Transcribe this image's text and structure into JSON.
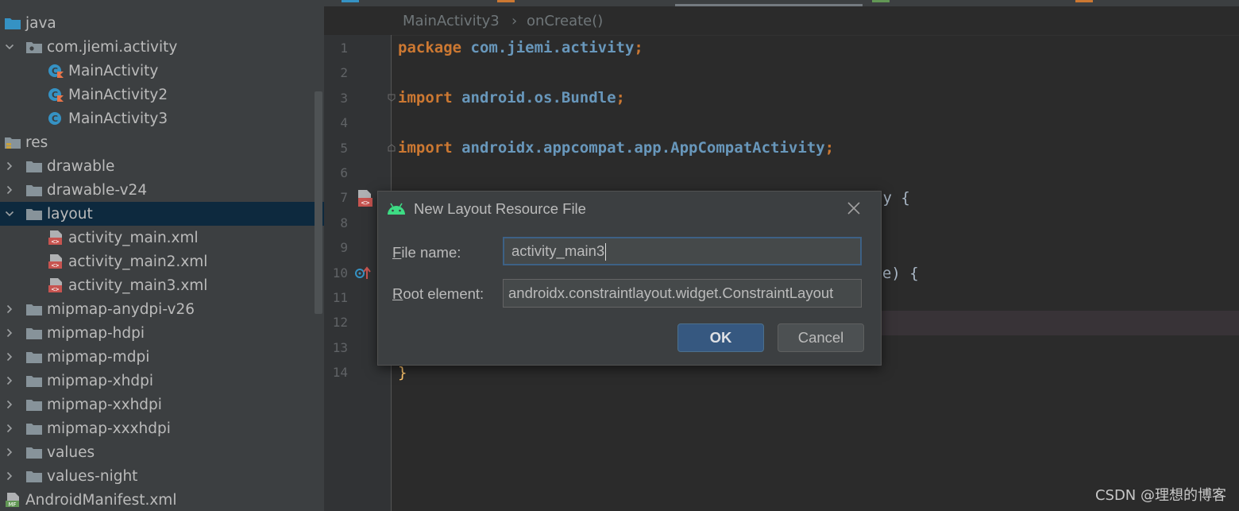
{
  "project_tree": {
    "items": [
      {
        "label": "java",
        "type": "src-folder",
        "expanded": null,
        "depth": 0
      },
      {
        "label": "com.jiemi.activity",
        "type": "package",
        "expanded": true,
        "depth": 1
      },
      {
        "label": "MainActivity",
        "type": "kotlin-class",
        "expanded": null,
        "depth": 2
      },
      {
        "label": "MainActivity2",
        "type": "kotlin-class",
        "expanded": null,
        "depth": 2
      },
      {
        "label": "MainActivity3",
        "type": "java-class",
        "expanded": null,
        "depth": 2
      },
      {
        "label": "res",
        "type": "res-folder",
        "expanded": null,
        "depth": 0
      },
      {
        "label": "drawable",
        "type": "folder",
        "expanded": false,
        "depth": 1
      },
      {
        "label": "drawable-v24",
        "type": "folder",
        "expanded": false,
        "depth": 1
      },
      {
        "label": "layout",
        "type": "folder",
        "expanded": true,
        "depth": 1,
        "selected": true
      },
      {
        "label": "activity_main.xml",
        "type": "layout-file",
        "expanded": null,
        "depth": 2
      },
      {
        "label": "activity_main2.xml",
        "type": "layout-file",
        "expanded": null,
        "depth": 2
      },
      {
        "label": "activity_main3.xml",
        "type": "layout-file",
        "expanded": null,
        "depth": 2
      },
      {
        "label": "mipmap-anydpi-v26",
        "type": "folder",
        "expanded": false,
        "depth": 1
      },
      {
        "label": "mipmap-hdpi",
        "type": "folder",
        "expanded": false,
        "depth": 1
      },
      {
        "label": "mipmap-mdpi",
        "type": "folder",
        "expanded": false,
        "depth": 1
      },
      {
        "label": "mipmap-xhdpi",
        "type": "folder",
        "expanded": false,
        "depth": 1
      },
      {
        "label": "mipmap-xxhdpi",
        "type": "folder",
        "expanded": false,
        "depth": 1
      },
      {
        "label": "mipmap-xxxhdpi",
        "type": "folder",
        "expanded": false,
        "depth": 1
      },
      {
        "label": "values",
        "type": "folder",
        "expanded": false,
        "depth": 1
      },
      {
        "label": "values-night",
        "type": "folder",
        "expanded": false,
        "depth": 1
      },
      {
        "label": "AndroidManifest.xml",
        "type": "manifest-file",
        "expanded": null,
        "depth": 0
      }
    ]
  },
  "breadcrumb": {
    "items": [
      "MainActivity3",
      "onCreate()"
    ],
    "separator": "›"
  },
  "editor": {
    "line_numbers": [
      "1",
      "2",
      "3",
      "4",
      "5",
      "6",
      "7",
      "8",
      "9",
      "10",
      "11",
      "12",
      "13",
      "14"
    ],
    "lines": {
      "l1_kw": "package",
      "l1_rest": " com.jiemi.activity",
      "l1_semi": ";",
      "l3_kw": "import",
      "l3_rest": " android.os.Bundle",
      "l3_semi": ";",
      "l5_kw": "import",
      "l5_rest": " androidx.appcompat.app.AppCompatActivity",
      "l5_semi": ";",
      "l7_frag": "ty {",
      "l10_frag": "ate) {",
      "l14": "}"
    },
    "current_line": "12"
  },
  "dialog": {
    "title": "New Layout Resource File",
    "file_name_mnemonic": "F",
    "file_name_label_rest": "ile name:",
    "file_name_value": "activity_main3",
    "root_element_mnemonic": "R",
    "root_element_label_rest": "oot element:",
    "root_element_value": "androidx.constraintlayout.widget.ConstraintLayout",
    "ok_label": "OK",
    "cancel_label": "Cancel"
  },
  "watermark": "CSDN @理想的博客",
  "colors": {
    "keyword": "#cc7832",
    "package": "#6897bb",
    "brace": "#ffc66d",
    "selection": "#0d293e",
    "ok_button": "#365880"
  }
}
